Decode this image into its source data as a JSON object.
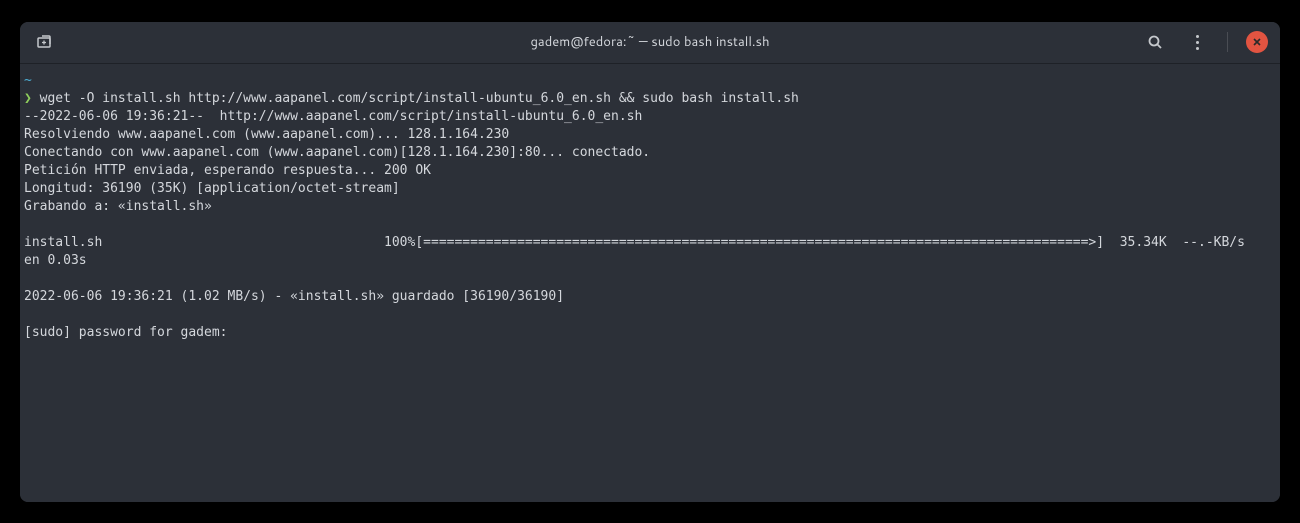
{
  "titlebar": {
    "title": "gadem@fedora:~ — sudo bash install.sh"
  },
  "terminal": {
    "tilde": "~",
    "prompt": "❯",
    "command": "wget -O install.sh http://www.aapanel.com/script/install-ubuntu_6.0_en.sh && sudo bash install.sh",
    "line1": "--2022-06-06 19:36:21--  http://www.aapanel.com/script/install-ubuntu_6.0_en.sh",
    "line2": "Resolviendo www.aapanel.com (www.aapanel.com)... 128.1.164.230",
    "line3": "Conectando con www.aapanel.com (www.aapanel.com)[128.1.164.230]:80... conectado.",
    "line4": "Petición HTTP enviada, esperando respuesta... 200 OK",
    "line5": "Longitud: 36190 (35K) [application/octet-stream]",
    "line6": "Grabando a: «install.sh»",
    "progress": "install.sh                                    100%[=====================================================================================>]  35.34K  --.-KB/s    en 0.03s   ",
    "line7": "2022-06-06 19:36:21 (1.02 MB/s) - «install.sh» guardado [36190/36190]",
    "line8": "[sudo] password for gadem: "
  }
}
